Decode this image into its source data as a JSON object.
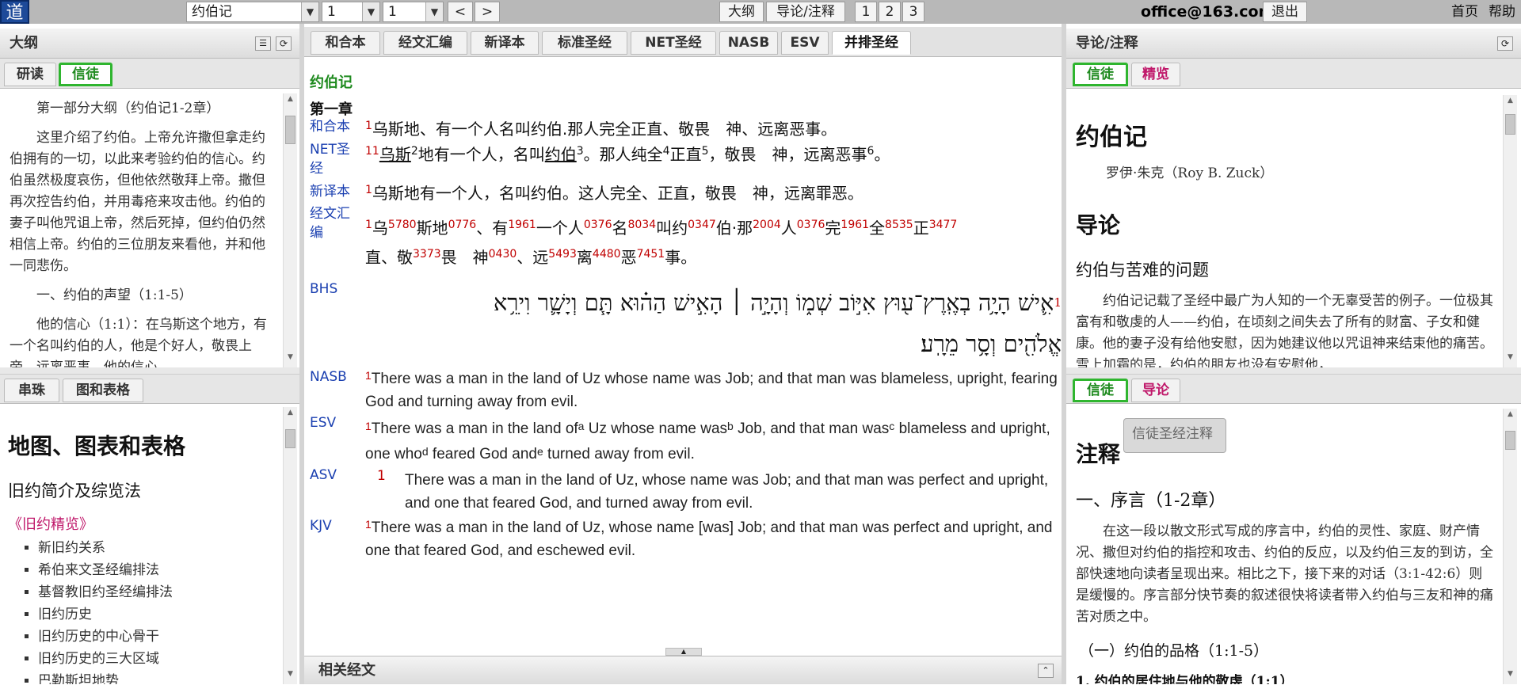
{
  "topbar": {
    "logo": "道",
    "book_select": "约伯记",
    "chapter_select": "1",
    "verse_select": "1",
    "prev": "<",
    "next": ">",
    "outline_btn": "大纲",
    "intro_notes_btn": "导论/注释",
    "layout_1": "1",
    "layout_2": "2",
    "layout_3": "3",
    "email": "office@163.com",
    "logout": "退出",
    "home": "首页",
    "help": "帮助"
  },
  "outline_panel": {
    "title": "大纲",
    "tabs": [
      "研读",
      "信徒"
    ],
    "paragraphs": [
      "第一部分大纲（约伯记1-2章）",
      "这里介绍了约伯。上帝允许撒但拿走约伯拥有的一切，以此来考验约伯的信心。约伯虽然极度哀伤，但他依然敬拜上帝。撒但再次控告约伯，并用毒疮来攻击他。约伯的妻子叫他咒诅上帝，然后死掉，但约伯仍然相信上帝。约伯的三位朋友来看他，并和他一同悲伤。",
      "一、约伯的声望（1:1-5）",
      "他的信心（1:1）：在乌斯这个地方，有一个名叫约伯的人，他是个好人，敬畏上帝，远离恶事，他的信心"
    ]
  },
  "maps_panel": {
    "tabs": [
      "串珠",
      "图和表格"
    ],
    "heading": "地图、图表和表格",
    "subheading": "旧约简介及综览法",
    "link_heading": "《旧约精览》",
    "items": [
      "新旧约关系",
      "希伯来文圣经编排法",
      "基督教旧约圣经编排法",
      "旧约历史",
      "旧约历史的中心骨干",
      "旧约历史的三大区域",
      "巴勒斯坦地势"
    ]
  },
  "center_panel": {
    "tabs": [
      "和合本",
      "经文汇编",
      "新译本",
      "标准圣经",
      "NET圣经",
      "NASB",
      "ESV",
      "并排圣经"
    ],
    "book_title": "约伯记",
    "chapter_title": "第一章",
    "labels": {
      "cuv": "和合本",
      "net": "NET圣经",
      "ncv": "新译本",
      "concordance": "经文汇编",
      "bhs": "BHS",
      "nasb": "NASB",
      "esv": "ESV",
      "asv": "ASV",
      "kjv": "KJV"
    },
    "verses": {
      "cuv": "乌斯地、有一个人名叫约伯.那人完全正直、敬畏　神、远离恶事。",
      "ncv": "乌斯地有一个人，名叫约伯。这人完全、正直，敬畏　神，远离罪恶。",
      "bhs_line1": "אִ֛ישׁ הָיָ֥ה בְאֶֽרֶץ־ע֖וּץ אִיּ֣וֹב שְׁמ֑וֹ וְהָיָ֣ה ׀ הָאִ֣ישׁ הַה֗וּא תָּ֧ם וְיָשָׁ֛ר וִירֵ֥א",
      "bhs_line2": "אֱלֹהִ֖ים וְסָ֥ר מֵרָֽע׃",
      "nasb": "There was a man in the land of Uz whose name was Job; and that man was blameless, upright, fearing God and turning away from evil.",
      "asv": "There was a man in the land of Uz, whose name was Job; and that man was perfect and upright, and one that feared God, and turned away from evil.",
      "kjv": "There was a man in the land of Uz, whose name [was] Job; and that man was perfect and upright, and one that feared God, and eschewed evil."
    },
    "verse_num": "1",
    "net_num": "11",
    "related": "相关经文"
  },
  "notes_panel": {
    "title": "导论/注释",
    "top_tabs": [
      "信徒",
      "精览"
    ],
    "book": "约伯记",
    "author": "罗伊·朱克（Roy B. Zuck）",
    "intro_heading": "导论",
    "sub_heading": "约伯与苦难的问题",
    "intro_para": "约伯记记载了圣经中最广为人知的一个无辜受苦的例子。一位极其富有和敬虔的人——约伯，在顷刻之间失去了所有的财富、子女和健康。他的妻子没有给他安慰，因为她建议他以咒诅神来结束他的痛苦。雪上加霜的是，约伯的朋友也没有安慰他，",
    "bottom_tabs": [
      "信徒",
      "导论"
    ],
    "tooltip": "信徒圣经注释",
    "notes_heading": "注释",
    "section1": "一、序言（1-2章）",
    "section1_para": "在这一段以散文形式写成的序言中，约伯的灵性、家庭、财产情况、撒但对约伯的指控和攻击、约伯的反应，以及约伯三友的到访，全部快速地向读者呈现出来。相比之下，接下来的对话（3:1-42:6）则是缓慢的。序言部分快节奏的叙述很快将读者带入约伯与三友和神的痛苦对质之中。",
    "sub1": "（一）约伯的品格（1:1-5）",
    "sub1a": "1. 约伯的居住地与他的敬虔（1:1）"
  }
}
